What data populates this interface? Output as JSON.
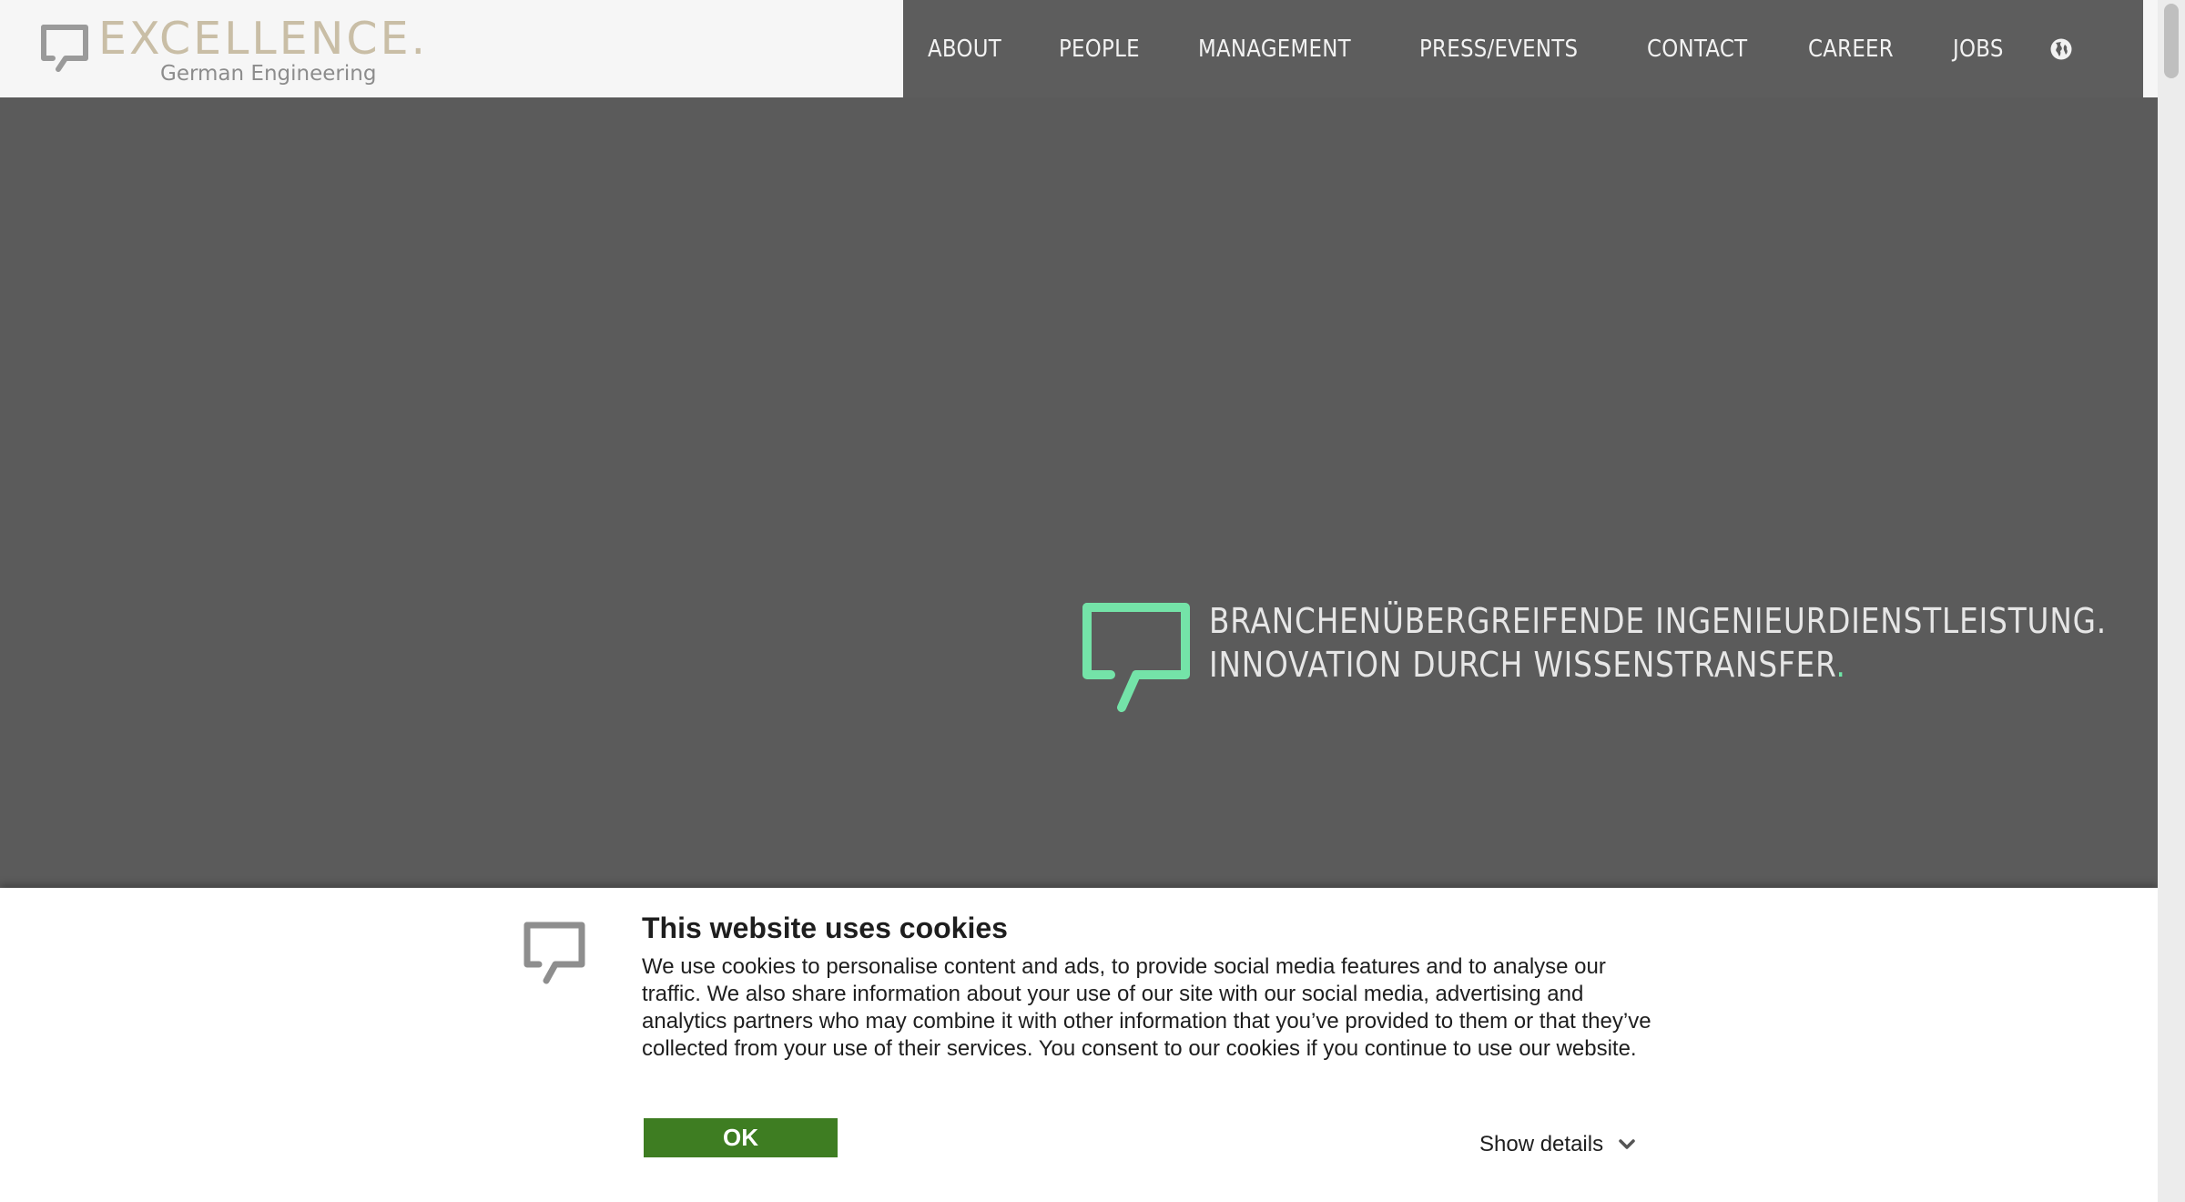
{
  "header": {
    "logo_word": "EXCELLENCE.",
    "logo_sub": "German Engineering",
    "nav": [
      {
        "label": "ABOUT"
      },
      {
        "label": "PEOPLE"
      },
      {
        "label": "MANAGEMENT"
      },
      {
        "label": "PRESS/EVENTS"
      },
      {
        "label": "CONTACT"
      },
      {
        "label": "CAREER"
      },
      {
        "label": "JOBS"
      }
    ],
    "language_icon": "globe-icon"
  },
  "hero": {
    "tagline_line1": "BRANCHENÜBERGREIFENDE INGENIEURDIENSTLEISTUNG.",
    "tagline_line2": "INNOVATION DURCH WISSENSTRANSFER",
    "tagline_dot": ".",
    "accent_color": "#6ee6a6"
  },
  "cookie_banner": {
    "title": "This website uses cookies",
    "text": "We use cookies to personalise content and ads, to provide social media features and to analyse our traffic. We also share information about your use of our site with our social media, advertising and analytics partners who may combine it with other information that you’ve provided to them or that they’ve collected from your use of their services. You consent to our cookies if you continue to use our website.",
    "ok_label": "OK",
    "details_label": "Show details",
    "button_color": "#3e7d22"
  }
}
